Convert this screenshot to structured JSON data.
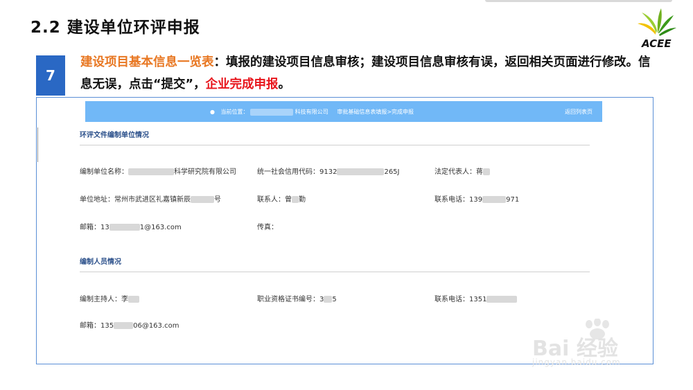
{
  "header": {
    "title": "2.2  建设单位环评申报",
    "logo_text": "ACEE"
  },
  "step": {
    "number": "7",
    "orange_text": "建设项目基本信息一览表",
    "text_a": "：填报的建设项目信息审核；建设项目信息审核有误，返回相关页面进行修改。信息无误，点击“提交”，",
    "red_text": "企业完成申报",
    "text_b": "。"
  },
  "screen": {
    "breadcrumb": {
      "prefix": "当前位置：",
      "company_suffix": "科技有限公司",
      "path": "审批基础信息表填报>完成申报",
      "back_link": "返回列表页"
    },
    "section1": {
      "title": "环评文件编制单位情况",
      "unit_name_label": "编制单位名称：",
      "unit_name_value": "科学研究院有限公司",
      "credit_code_label": "统一社会信用代码：",
      "credit_code_start": "9132",
      "credit_code_end": "265J",
      "legal_rep_label": "法定代表人：",
      "legal_rep_value": "蒋",
      "address_label": "单位地址：",
      "address_value": "常州市武进区礼嘉镇新辰",
      "address_end": "号",
      "contact_label": "联系人：",
      "contact_value": "曾",
      "contact_end": "勤",
      "phone_label": "联系电话：",
      "phone_start": "139",
      "phone_end": "971",
      "email_label": "邮箱：",
      "email_start": "13",
      "email_end": "1@163.com",
      "fax_label": "传真："
    },
    "section2": {
      "title": "编制人员情况",
      "host_label": "编制主持人：",
      "host_value": "李",
      "cert_label": "职业资格证书编号：",
      "cert_start": "3",
      "cert_end": "5",
      "phone_label": "联系电话：",
      "phone_start": "1351",
      "email_label": "邮箱：",
      "email_start": "135",
      "email_end": "06@163.com"
    }
  },
  "watermark": {
    "brand": "Bai 经验",
    "url": "jingyan.baidu.com"
  }
}
